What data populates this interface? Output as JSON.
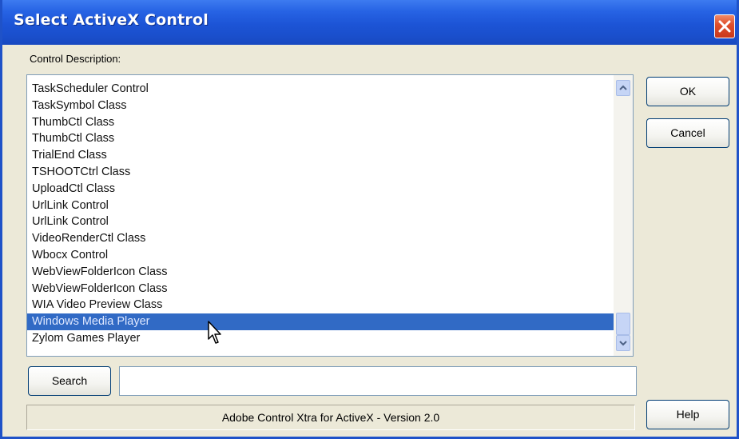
{
  "window": {
    "title": "Select ActiveX Control"
  },
  "control_description_label": "Control Description:",
  "list": {
    "items": [
      "TaskScheduler Control",
      "TaskSymbol Class",
      "ThumbCtl Class",
      "ThumbCtl Class",
      "TrialEnd Class",
      "TSHOOTCtrl Class",
      "UploadCtl Class",
      "UrlLink Control",
      "UrlLink Control",
      "VideoRenderCtl Class",
      "Wbocx Control",
      "WebViewFolderIcon Class",
      "WebViewFolderIcon Class",
      "WIA Video Preview Class",
      "Windows Media Player",
      "Zylom Games Player"
    ],
    "selected_item": "Windows Media Player"
  },
  "buttons": {
    "ok": "OK",
    "cancel": "Cancel",
    "search": "Search",
    "help": "Help"
  },
  "search_input": {
    "value": ""
  },
  "status_text": "Adobe Control Xtra for ActiveX - Version 2.0",
  "colors": {
    "titlebar": "#1c54d6",
    "selection": "#316ac5",
    "dialog_background": "#ece9d8"
  }
}
